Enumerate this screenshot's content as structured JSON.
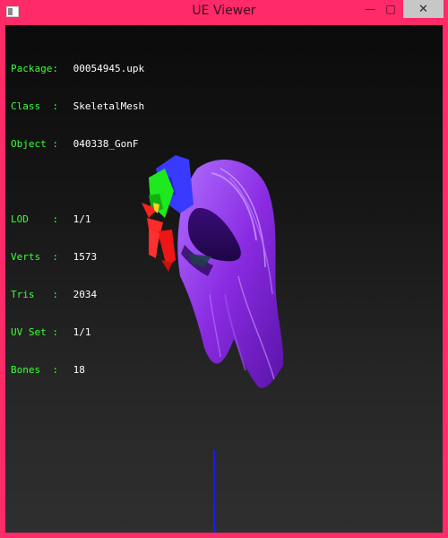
{
  "window": {
    "title": "UE Viewer",
    "minimize_glyph": "—",
    "maximize_glyph": "□",
    "close_glyph": "✕"
  },
  "info": {
    "package": {
      "label": "Package:",
      "value": "00054945.upk"
    },
    "class": {
      "label": "Class  :",
      "value": "SkeletalMesh"
    },
    "object": {
      "label": "Object :",
      "value": "040338_GonF"
    },
    "lod": {
      "label": "LOD    :",
      "value": "1/1"
    },
    "verts": {
      "label": "Verts  :",
      "value": "1573"
    },
    "tris": {
      "label": "Tris   :",
      "value": "2034"
    },
    "uvset": {
      "label": "UV Set :",
      "value": "1/1"
    },
    "bones": {
      "label": "Bones  :",
      "value": "18"
    }
  },
  "colors": {
    "window_frame": "#ff2a68",
    "info_label": "#3bff3b",
    "info_value": "#ffffff",
    "hair_purple": "#8a2be2",
    "axis_blue": "#1a1aff"
  }
}
